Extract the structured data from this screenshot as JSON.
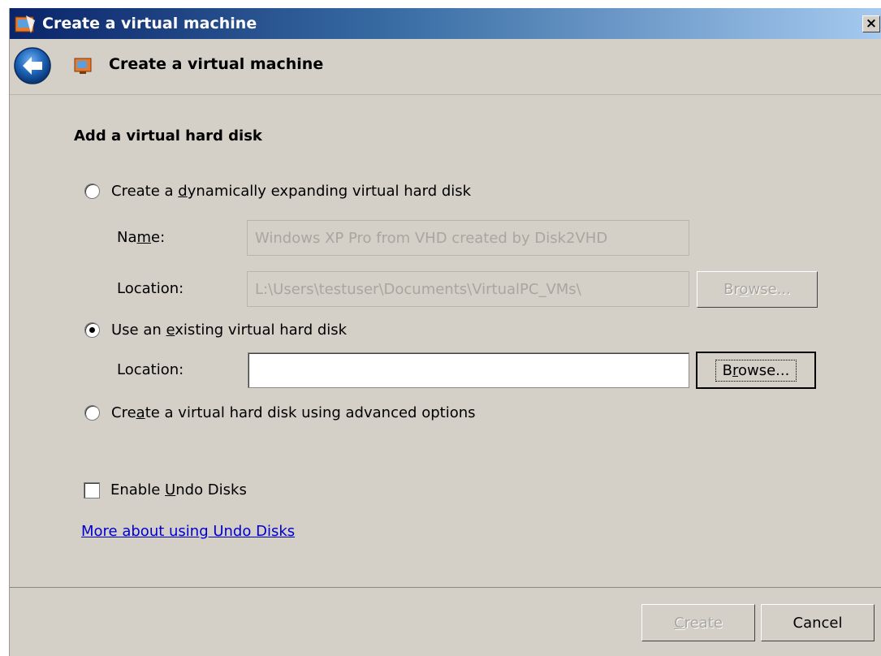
{
  "window": {
    "title": "Create a virtual machine",
    "close_glyph": "×"
  },
  "nav": {
    "title": "Create a virtual machine",
    "back_icon": "back-arrow-icon",
    "page_icon": "virtual-pc-icon"
  },
  "main": {
    "heading": "Add a virtual hard disk",
    "option_dynamic": {
      "label_pre": "Create a ",
      "label_accel": "d",
      "label_post": "ynamically expanding virtual hard disk",
      "selected": false
    },
    "name_label_pre": "Na",
    "name_label_accel": "m",
    "name_label_post": "e:",
    "name_value": "Windows XP Pro from VHD created by Disk2VHD",
    "location_label_1": "Location:",
    "location_value_1": "L:\\Users\\testuser\\Documents\\VirtualPC_VMs\\",
    "browse_1_pre": "Br",
    "browse_1_accel": "o",
    "browse_1_post": "wse...",
    "option_existing": {
      "label_pre": "Use an ",
      "label_accel": "e",
      "label_post": "xisting virtual hard disk",
      "selected": true
    },
    "location_label_2_pre": "Location",
    "location_label_2_accel": "",
    "location_label_2_post": ":",
    "location_value_2": "",
    "browse_2_pre": "B",
    "browse_2_accel": "r",
    "browse_2_post": "owse...",
    "option_advanced": {
      "label_pre": "Cre",
      "label_accel": "a",
      "label_post": "te a virtual hard disk using advanced options",
      "selected": false
    },
    "undo": {
      "label_pre": "Enable ",
      "label_accel": "U",
      "label_post": "ndo Disks",
      "checked": false
    },
    "link": "More about using Undo Disks"
  },
  "footer": {
    "create_accel": "C",
    "create_rest": "reate",
    "cancel_label": "Cancel"
  }
}
